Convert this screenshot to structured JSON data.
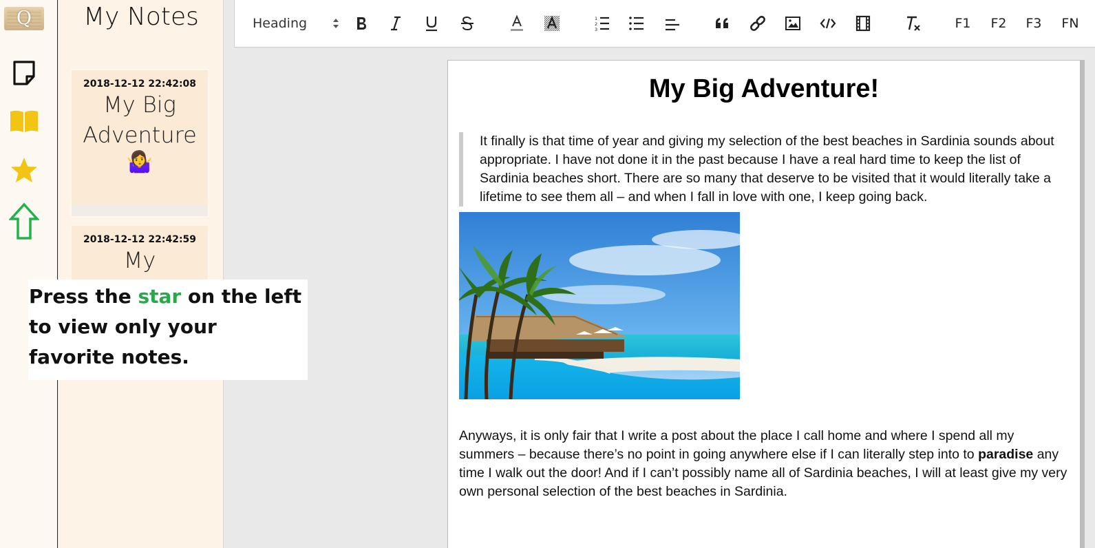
{
  "app": {
    "logo_letter": "Q",
    "rail_icons": [
      "sticky-note-icon",
      "book-icon",
      "star-icon",
      "upload-arrow-icon"
    ],
    "colors": {
      "book": "#f2c413",
      "star": "#f2c413",
      "upload": "#22b24c",
      "tooltip_highlight": "#2aa64b"
    }
  },
  "notes_panel": {
    "title": "My Notes",
    "cards": [
      {
        "date": "2018-12-12 22:42:08",
        "title": "My Big Adventure",
        "emoji": "🤷‍♀️"
      },
      {
        "date": "2018-12-12 22:42:59",
        "title": "My Favorite"
      }
    ]
  },
  "tooltip": {
    "before": "Press the ",
    "highlight": "star",
    "after": " on the left to view only your favorite notes."
  },
  "toolbar": {
    "heading_select": "Heading",
    "buttons": [
      "bold-icon",
      "italic-icon",
      "underline-icon",
      "strikethrough-icon",
      "font-color-icon",
      "background-color-icon",
      "ordered-list-icon",
      "bullet-list-icon",
      "align-icon",
      "blockquote-icon",
      "link-icon",
      "image-icon",
      "code-icon",
      "video-icon",
      "clear-format-icon"
    ],
    "f1": "F1",
    "f2": "F2",
    "f3": "F3",
    "fn": "FN"
  },
  "editor": {
    "title": "My Big Adventure!",
    "quote": "It finally is that time of year and giving my selection of the best beaches in Sardinia sounds about appropriate. I have not done it in the past because I have a real hard time to keep the list of Sardinia beaches short. There are so many that deserve to be visited that it would literally take a lifetime to see them all – and when I fall in love with one, I keep going back.",
    "para_before": "Anyways, it is only fair that I write a post about the place I call home and where I spend all my summers – because there’s no point in going anywhere else if I can literally step into to ",
    "para_bold": "paradise",
    "para_after": " any time I walk out the door! And if I can’t possibly name all of Sardinia beaches, I will at least give my very own personal selection of the best beaches in Sardinia."
  }
}
